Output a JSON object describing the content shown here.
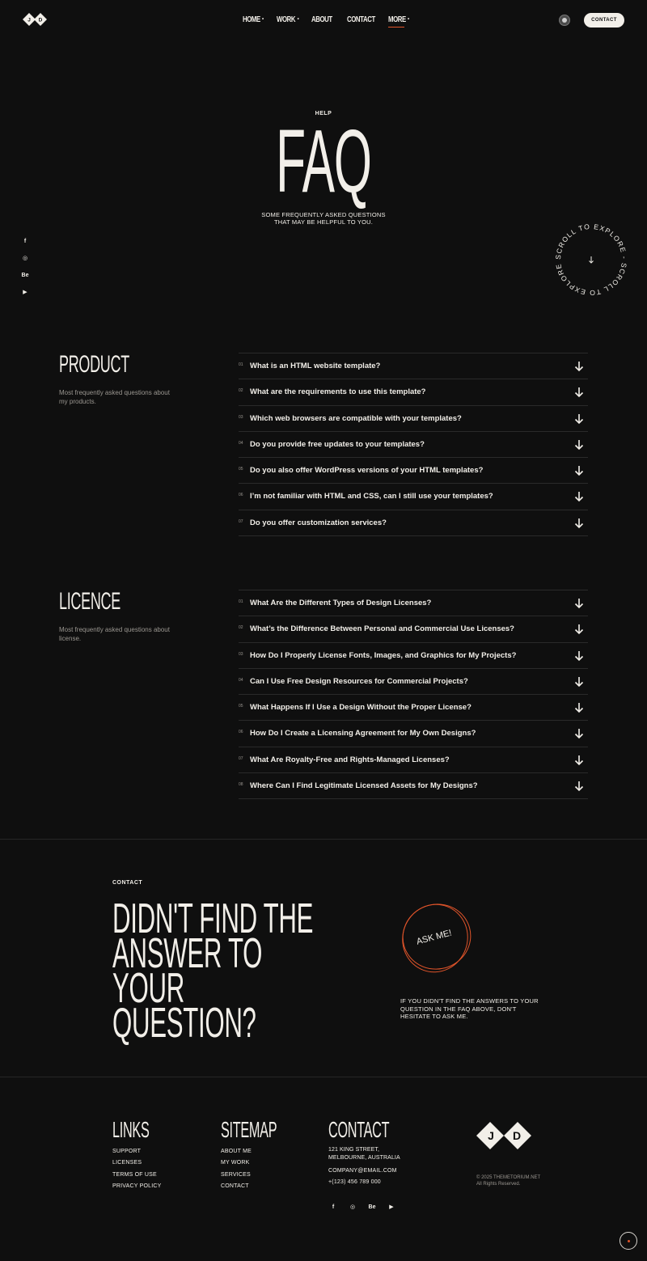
{
  "header": {
    "logo_letters": "J D",
    "nav": [
      {
        "label": "HOME",
        "has_dropdown": true
      },
      {
        "label": "WORK",
        "has_dropdown": true
      },
      {
        "label": "ABOUT",
        "has_dropdown": false
      },
      {
        "label": "CONTACT",
        "has_dropdown": false
      },
      {
        "label": "MORE",
        "has_dropdown": true,
        "active": true
      }
    ],
    "contact_button": "CONTACT"
  },
  "hero": {
    "eyebrow": "HELP",
    "title": "FAQ",
    "subtitle_line1": "SOME FREQUENTLY ASKED QUESTIONS",
    "subtitle_line2": "THAT MAY BE HELPFUL TO YOU.",
    "scroll_badge_text": "SCROLL TO EXPLORE - SCROLL TO EXPLORE - "
  },
  "socials": [
    "f",
    "◎",
    "Be",
    "▶"
  ],
  "product": {
    "heading": "PRODUCT",
    "description": "Most frequently asked questions about my products.",
    "items": [
      {
        "num": "01",
        "question": "What is an HTML website template?"
      },
      {
        "num": "02",
        "question": "What are the requirements to use this template?"
      },
      {
        "num": "03",
        "question": "Which web browsers are compatible with your templates?"
      },
      {
        "num": "04",
        "question": "Do you provide free updates to your templates?"
      },
      {
        "num": "05",
        "question": "Do you also offer WordPress versions of your HTML templates?"
      },
      {
        "num": "06",
        "question": "I’m not familiar with HTML and CSS, can I still use your templates?"
      },
      {
        "num": "07",
        "question": "Do you offer customization services?"
      }
    ]
  },
  "licence": {
    "heading": "LICENCE",
    "description": "Most frequently asked questions about license.",
    "items": [
      {
        "num": "01",
        "question": "What Are the Different Types of Design Licenses?"
      },
      {
        "num": "02",
        "question": "What’s the Difference Between Personal and Commercial Use Licenses?"
      },
      {
        "num": "03",
        "question": "How Do I Properly License Fonts, Images, and Graphics for My Projects?"
      },
      {
        "num": "04",
        "question": "Can I Use Free Design Resources for Commercial Projects?"
      },
      {
        "num": "05",
        "question": "What Happens If I Use a Design Without the Proper License?"
      },
      {
        "num": "06",
        "question": "How Do I Create a Licensing Agreement for My Own Designs?"
      },
      {
        "num": "07",
        "question": "What Are Royalty-Free and Rights-Managed Licenses?"
      },
      {
        "num": "08",
        "question": "Where Can I Find Legitimate Licensed Assets for My Designs?"
      }
    ]
  },
  "cta": {
    "eyebrow": "CONTACT",
    "title_line1": "DIDN'T FIND THE",
    "title_line2": "ANSWER TO YOUR",
    "title_line3": "QUESTION?",
    "badge_label": "ASK ME!",
    "text": "IF YOU DIDN'T FIND THE ANSWERS TO YOUR QUESTION IN THE FAQ ABOVE, DON'T HESITATE TO ASK ME."
  },
  "footer": {
    "links_heading": "LINKS",
    "links": [
      "SUPPORT",
      "LICENSES",
      "TERMS OF USE",
      "PRIVACY POLICY"
    ],
    "sitemap_heading": "SITEMAP",
    "sitemap": [
      "ABOUT ME",
      "MY WORK",
      "SERVICES",
      "CONTACT"
    ],
    "contact_heading": "CONTACT",
    "address_line1": "121 KING STREET,",
    "address_line2": "MELBOURNE, AUSTRALIA",
    "email": "COMPANY@EMAIL.COM",
    "phone": "+(123) 456 789 000",
    "copyright_line1": "© 2025 THEMETORIUM.NET",
    "copyright_line2": "All Rights Reserved."
  },
  "colors": {
    "background": "#0f0f0f",
    "text": "#f2efe9",
    "accent": "#e0542a",
    "muted": "#9a9690"
  }
}
